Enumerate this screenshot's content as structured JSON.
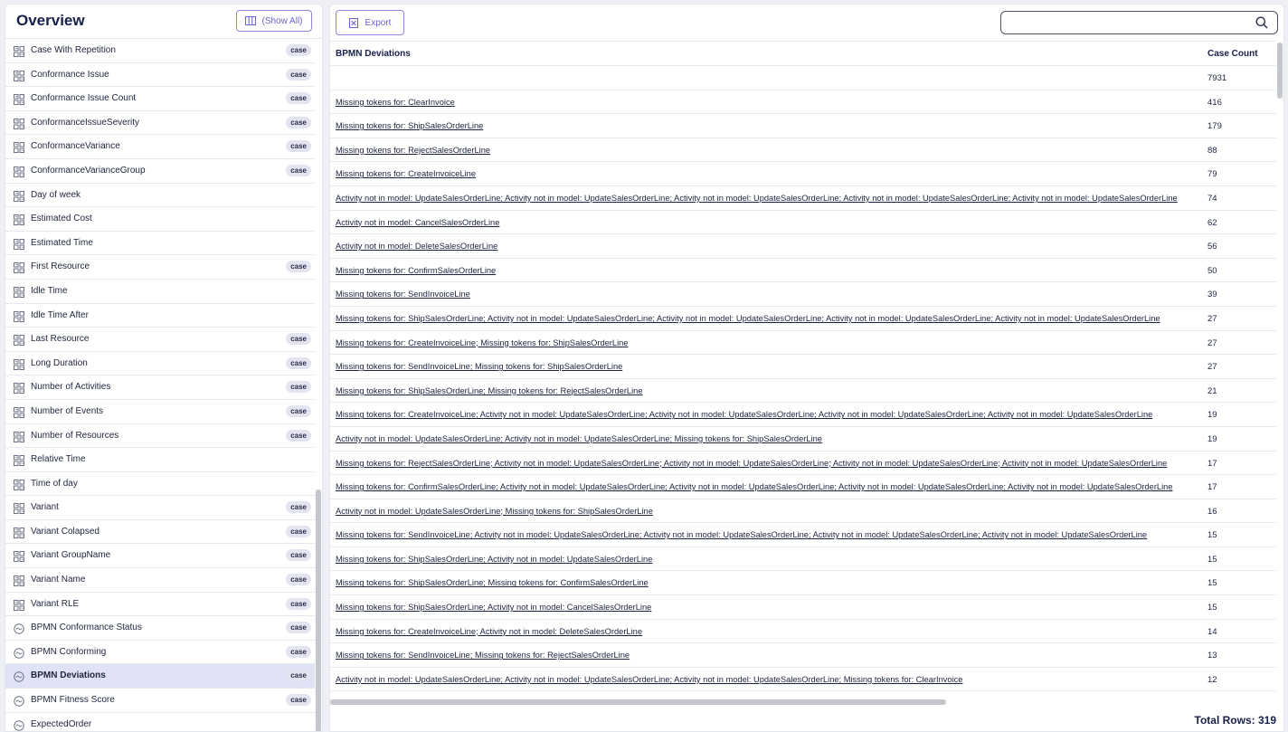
{
  "sidebar": {
    "title": "Overview",
    "show_all_label": "(Show All)",
    "items": [
      {
        "label": "Case With Repetition",
        "badge": "case",
        "icon": "table-icon"
      },
      {
        "label": "Conformance Issue",
        "badge": "case",
        "icon": "table-icon"
      },
      {
        "label": "Conformance Issue Count",
        "badge": "case",
        "icon": "table-icon"
      },
      {
        "label": "ConformanceIssueSeverity",
        "badge": "case",
        "icon": "table-icon"
      },
      {
        "label": "ConformanceVariance",
        "badge": "case",
        "icon": "table-icon"
      },
      {
        "label": "ConformanceVarianceGroup",
        "badge": "case",
        "icon": "table-icon"
      },
      {
        "label": "Day of week",
        "badge": "",
        "icon": "table-icon"
      },
      {
        "label": "Estimated Cost",
        "badge": "",
        "icon": "table-icon"
      },
      {
        "label": "Estimated Time",
        "badge": "",
        "icon": "table-icon"
      },
      {
        "label": "First Resource",
        "badge": "case",
        "icon": "table-icon"
      },
      {
        "label": "Idle Time",
        "badge": "",
        "icon": "table-icon"
      },
      {
        "label": "Idle Time After",
        "badge": "",
        "icon": "table-icon"
      },
      {
        "label": "Last Resource",
        "badge": "case",
        "icon": "table-icon"
      },
      {
        "label": "Long Duration",
        "badge": "case",
        "icon": "table-icon"
      },
      {
        "label": "Number of Activities",
        "badge": "case",
        "icon": "table-icon"
      },
      {
        "label": "Number of Events",
        "badge": "case",
        "icon": "table-icon"
      },
      {
        "label": "Number of Resources",
        "badge": "case",
        "icon": "table-icon"
      },
      {
        "label": "Relative Time",
        "badge": "",
        "icon": "table-icon"
      },
      {
        "label": "Time of day",
        "badge": "",
        "icon": "table-icon"
      },
      {
        "label": "Variant",
        "badge": "case",
        "icon": "table-icon"
      },
      {
        "label": "Variant Colapsed",
        "badge": "case",
        "icon": "table-icon"
      },
      {
        "label": "Variant GroupName",
        "badge": "case",
        "icon": "table-icon"
      },
      {
        "label": "Variant Name",
        "badge": "case",
        "icon": "table-icon"
      },
      {
        "label": "Variant RLE",
        "badge": "case",
        "icon": "table-icon"
      },
      {
        "label": "BPMN Conformance Status",
        "badge": "case",
        "icon": "bpmn-circle-icon"
      },
      {
        "label": "BPMN Conforming",
        "badge": "case",
        "icon": "bpmn-circle-icon"
      },
      {
        "label": "BPMN Deviations",
        "badge": "case",
        "icon": "bpmn-circle-icon",
        "selected": true
      },
      {
        "label": "BPMN Fitness Score",
        "badge": "case",
        "icon": "bpmn-circle-icon"
      },
      {
        "label": "ExpectedOrder",
        "badge": "",
        "icon": "bpmn-circle-icon"
      }
    ]
  },
  "toolbar": {
    "export_label": "Export",
    "search_placeholder": "",
    "search_value": ""
  },
  "table": {
    "columns": [
      "BPMN Deviations",
      "Case Count"
    ],
    "rows": [
      {
        "deviation": "",
        "count": "7931"
      },
      {
        "deviation": "Missing tokens for: ClearInvoice",
        "count": "416"
      },
      {
        "deviation": "Missing tokens for: ShipSalesOrderLine",
        "count": "179"
      },
      {
        "deviation": "Missing tokens for: RejectSalesOrderLine",
        "count": "88"
      },
      {
        "deviation": "Missing tokens for: CreateInvoiceLine",
        "count": "79"
      },
      {
        "deviation": "Activity not in model: UpdateSalesOrderLine; Activity not in model: UpdateSalesOrderLine; Activity not in model: UpdateSalesOrderLine; Activity not in model: UpdateSalesOrderLine; Activity not in model: UpdateSalesOrderLine",
        "count": "74"
      },
      {
        "deviation": "Activity not in model: CancelSalesOrderLine",
        "count": "62"
      },
      {
        "deviation": "Activity not in model: DeleteSalesOrderLine",
        "count": "56"
      },
      {
        "deviation": "Missing tokens for: ConfirmSalesOrderLine",
        "count": "50"
      },
      {
        "deviation": "Missing tokens for: SendInvoiceLine",
        "count": "39"
      },
      {
        "deviation": "Missing tokens for: ShipSalesOrderLine; Activity not in model: UpdateSalesOrderLine; Activity not in model: UpdateSalesOrderLine; Activity not in model: UpdateSalesOrderLine; Activity not in model: UpdateSalesOrderLine",
        "count": "27"
      },
      {
        "deviation": "Missing tokens for: CreateInvoiceLine; Missing tokens for: ShipSalesOrderLine",
        "count": "27"
      },
      {
        "deviation": "Missing tokens for: SendInvoiceLine; Missing tokens for: ShipSalesOrderLine",
        "count": "27"
      },
      {
        "deviation": "Missing tokens for: ShipSalesOrderLine; Missing tokens for: RejectSalesOrderLine",
        "count": "21"
      },
      {
        "deviation": "Missing tokens for: CreateInvoiceLine; Activity not in model: UpdateSalesOrderLine; Activity not in model: UpdateSalesOrderLine; Activity not in model: UpdateSalesOrderLine; Activity not in model: UpdateSalesOrderLine",
        "count": "19"
      },
      {
        "deviation": "Activity not in model: UpdateSalesOrderLine; Activity not in model: UpdateSalesOrderLine; Missing tokens for: ShipSalesOrderLine",
        "count": "19"
      },
      {
        "deviation": "Missing tokens for: RejectSalesOrderLine; Activity not in model: UpdateSalesOrderLine; Activity not in model: UpdateSalesOrderLine; Activity not in model: UpdateSalesOrderLine; Activity not in model: UpdateSalesOrderLine",
        "count": "17"
      },
      {
        "deviation": "Missing tokens for: ConfirmSalesOrderLine; Activity not in model: UpdateSalesOrderLine; Activity not in model: UpdateSalesOrderLine; Activity not in model: UpdateSalesOrderLine; Activity not in model: UpdateSalesOrderLine",
        "count": "17"
      },
      {
        "deviation": "Activity not in model: UpdateSalesOrderLine; Missing tokens for: ShipSalesOrderLine",
        "count": "16"
      },
      {
        "deviation": "Missing tokens for: SendInvoiceLine; Activity not in model: UpdateSalesOrderLine; Activity not in model: UpdateSalesOrderLine; Activity not in model: UpdateSalesOrderLine; Activity not in model: UpdateSalesOrderLine",
        "count": "15"
      },
      {
        "deviation": "Missing tokens for: ShipSalesOrderLine; Activity not in model: UpdateSalesOrderLine",
        "count": "15"
      },
      {
        "deviation": "Missing tokens for: ShipSalesOrderLine; Missing tokens for: ConfirmSalesOrderLine",
        "count": "15"
      },
      {
        "deviation": "Missing tokens for: ShipSalesOrderLine; Activity not in model: CancelSalesOrderLine",
        "count": "15"
      },
      {
        "deviation": "Missing tokens for: CreateInvoiceLine; Activity not in model: DeleteSalesOrderLine",
        "count": "14"
      },
      {
        "deviation": "Missing tokens for: SendInvoiceLine; Missing tokens for: RejectSalesOrderLine",
        "count": "13"
      },
      {
        "deviation": "Activity not in model: UpdateSalesOrderLine; Activity not in model: UpdateSalesOrderLine; Activity not in model: UpdateSalesOrderLine; Missing tokens for: ClearInvoice",
        "count": "12"
      }
    ]
  },
  "footer": {
    "total_rows": "Total Rows: 319"
  },
  "colors": {
    "accent": "#6a62d3",
    "selected_row": "#dfe3f5",
    "badge_bg": "#e3e4f0"
  }
}
